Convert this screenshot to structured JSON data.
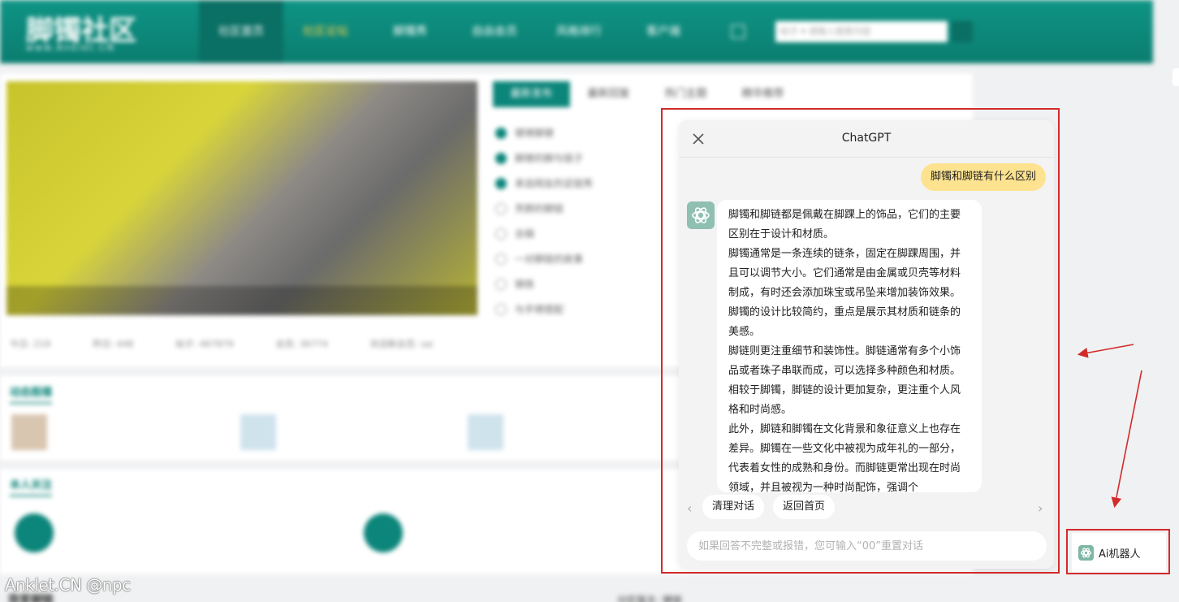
{
  "background_site": {
    "logo": "脚镯社区",
    "logo_sub": "www.Anklet.CN",
    "nav": [
      "社区首页",
      "社区论坛",
      "脚镯秀",
      "自由会员",
      "风格排行",
      "客户端"
    ],
    "search_placeholder": "帖子 ▾ 请输入搜索内容",
    "tabs": [
      "最新发布",
      "最新回复",
      "热门主题",
      "精华推荐"
    ],
    "list_items": [
      "镣铐脚镣",
      "脚镣的脚与链子",
      "来自网友的足链秀",
      "芳群的脚链",
      "合辑",
      "一对脚链的故事",
      "铸铁",
      "与手铐搭配"
    ],
    "stats": [
      "今日: 219",
      "昨日: 448",
      "帖子: 467879",
      "会员: 36774",
      "欢迎新会员: sai"
    ],
    "sections": [
      "动态图播",
      "本人关注"
    ],
    "bottom_section": "我爱脚链",
    "bottom_right": "分区版主: 镣链"
  },
  "watermark": "Anklet.CN @npc",
  "chat": {
    "title": "ChatGPT",
    "user_message": "脚镯和脚链有什么区别",
    "bot_message": [
      "脚镯和脚链都是佩戴在脚踝上的饰品，它们的主要区别在于设计和材质。",
      "脚镯通常是一条连续的链条，固定在脚踝周围，并且可以调节大小。它们通常是由金属或贝壳等材料制成，有时还会添加珠宝或吊坠来增加装饰效果。脚镯的设计比较简约，重点是展示其材质和链条的美感。",
      "脚链则更注重细节和装饰性。脚链通常有多个小饰品或者珠子串联而成，可以选择多种颜色和材质。相较于脚镯，脚链的设计更加复杂，更注重个人风格和时尚感。",
      "此外，脚链和脚镯在文化背景和象征意义上也存在差异。脚镯在一些文化中被视为成年礼的一部分，代表着女性的成熟和身份。而脚链更常出现在时尚领域，并且被视为一种时尚配饰，强调个"
    ],
    "quick_actions": [
      "清理对话",
      "返回首页"
    ],
    "input_placeholder": "如果回答不完整或报错，您可输入“00”重置对话",
    "input_value": ""
  },
  "ai_button": {
    "label": "Ai机器人",
    "icon": "openai-icon"
  },
  "colors": {
    "brand": "#0c857a",
    "user_bubble": "#fde38f",
    "annotation": "#d32a2a"
  }
}
